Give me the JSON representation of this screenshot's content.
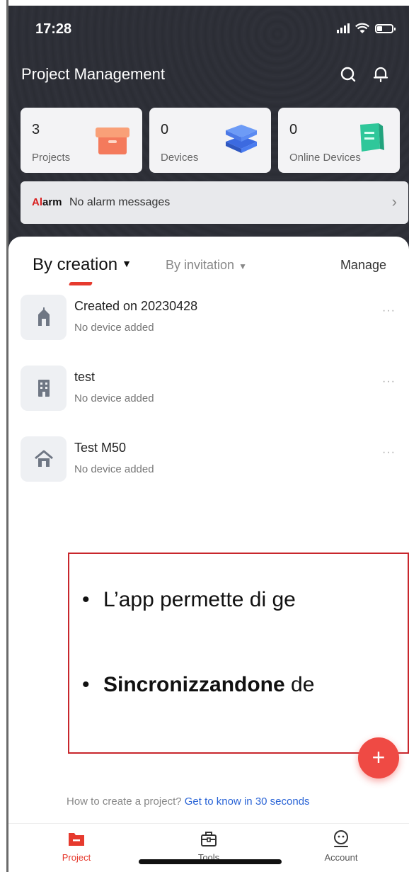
{
  "status_bar": {
    "time": "17:28"
  },
  "header": {
    "title": "Project Management",
    "icons": [
      "search-icon",
      "bell-icon"
    ]
  },
  "stats": [
    {
      "value": "3",
      "label": "Projects",
      "icon": "box-icon",
      "accent": "#f47a5c"
    },
    {
      "value": "0",
      "label": "Devices",
      "icon": "server-stack-icon",
      "accent": "#4d7ef0"
    },
    {
      "value": "0",
      "label": "Online Devices",
      "icon": "online-device-icon",
      "accent": "#2fc79a"
    }
  ],
  "alarm": {
    "tag_prefix": "Al",
    "tag_suffix": "arm",
    "message": "No alarm messages"
  },
  "tabs": {
    "active": "By creation",
    "secondary": "By invitation",
    "manage": "Manage"
  },
  "projects": [
    {
      "name": "Created on 20230428",
      "subtitle": "No device added",
      "icon": "school-icon"
    },
    {
      "name": "test",
      "subtitle": "No device added",
      "icon": "building-icon"
    },
    {
      "name": "Test M50",
      "subtitle": "No device added",
      "icon": "house-icon"
    }
  ],
  "overlay": {
    "bullet1": "L’app permette di ge",
    "bullet2_bold": "Sincronizzandone",
    "bullet2_rest": " de"
  },
  "fab": {
    "label": "+"
  },
  "help": {
    "question": "How to create a project? ",
    "link": "Get to know in 30 seconds"
  },
  "tabbar": [
    {
      "label": "Project",
      "active": true
    },
    {
      "label": "Tools",
      "active": false
    },
    {
      "label": "Account",
      "active": false
    }
  ],
  "colors": {
    "accent": "#e63a2e",
    "link": "#2a64d6",
    "overlay_border": "#c8262c",
    "fab": "#ef4a44"
  }
}
